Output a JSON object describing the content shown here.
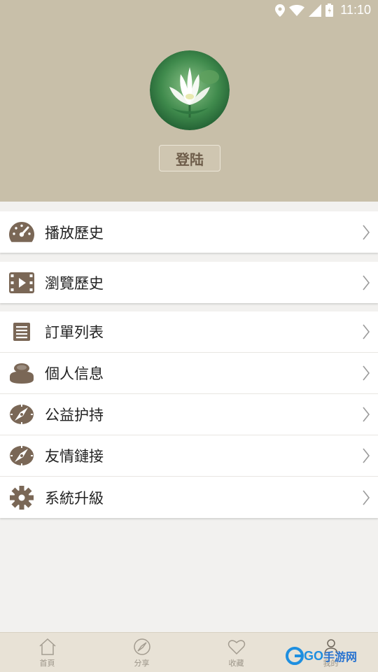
{
  "status_bar": {
    "time": "11:10",
    "icons": [
      "location-icon",
      "wifi-icon",
      "signal-icon",
      "battery-icon"
    ]
  },
  "colors": {
    "header_bg": "#c8bfa9",
    "icon_brown": "#7a6756",
    "page_bg": "#f2f1ef",
    "tabbar_bg": "#e8e2d6"
  },
  "profile": {
    "login_label": "登陆"
  },
  "menu": {
    "group1": [
      {
        "label": "播放歷史",
        "icon": "speedometer-icon"
      }
    ],
    "group2": [
      {
        "label": "瀏覽歷史",
        "icon": "video-film-icon"
      }
    ],
    "group3": [
      {
        "label": "訂單列表",
        "icon": "list-icon"
      },
      {
        "label": "個人信息",
        "icon": "user-stack-icon"
      },
      {
        "label": "公益护持",
        "icon": "compass-icon"
      },
      {
        "label": "友情鏈接",
        "icon": "compass-icon"
      },
      {
        "label": "系統升級",
        "icon": "gear-icon"
      }
    ]
  },
  "tabs": [
    {
      "label": "首頁",
      "icon": "home-icon"
    },
    {
      "label": "分享",
      "icon": "share-icon"
    },
    {
      "label": "收藏",
      "icon": "heart-icon"
    },
    {
      "label": "我的",
      "icon": "user-icon"
    }
  ],
  "watermark": {
    "brand": "GO",
    "text": "手游网"
  }
}
